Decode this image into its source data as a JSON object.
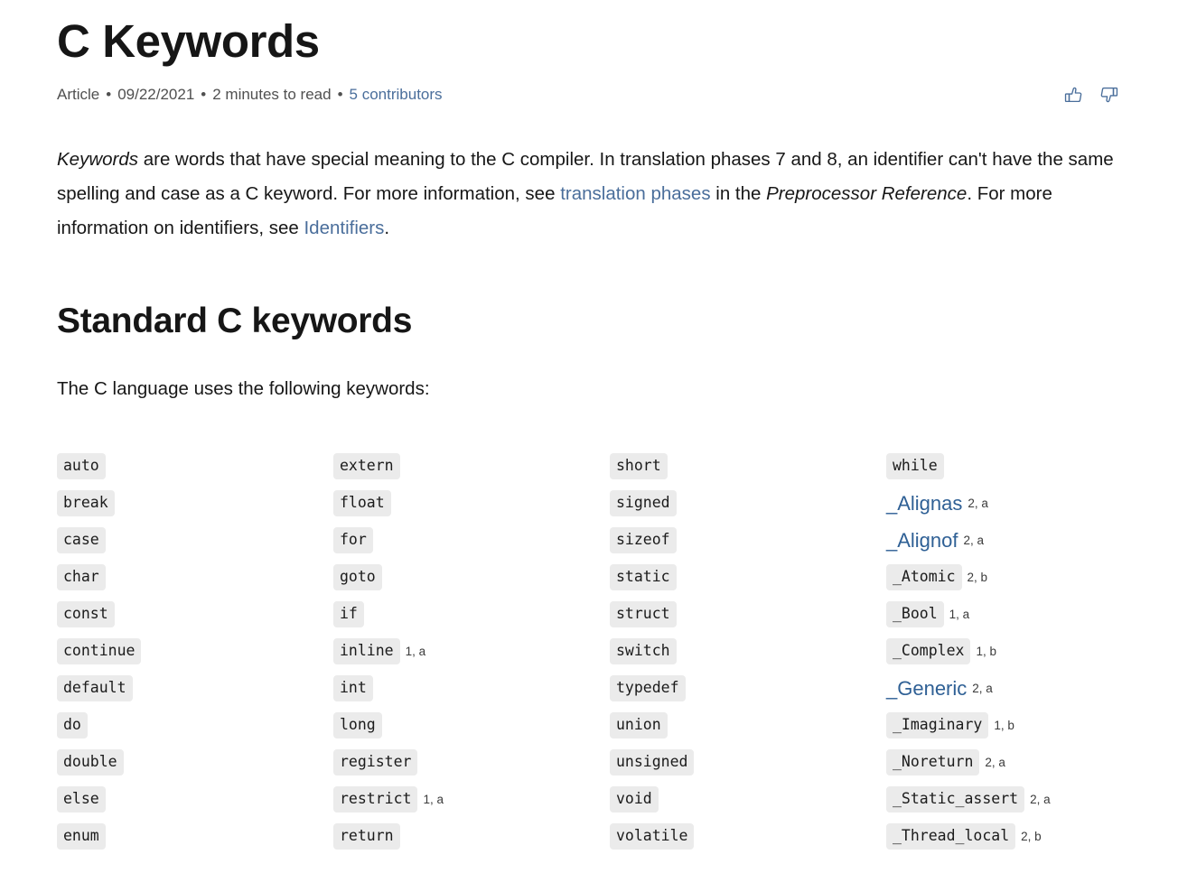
{
  "header": {
    "title": "C Keywords",
    "meta": {
      "type": "Article",
      "date": "09/22/2021",
      "read_time": "2 minutes to read",
      "contributors": "5 contributors",
      "separator": "•"
    },
    "feedback": {
      "thumbs_up_icon": "thumbs-up-icon",
      "thumbs_down_icon": "thumbs-down-icon"
    },
    "link_color": "#4a6e9b"
  },
  "intro": {
    "p1_a": "Keywords",
    "p1_b": " are words that have special meaning to the C compiler. In translation phases 7 and 8, an identifier can't have the same spelling and case as a C keyword. For more information, see ",
    "p1_link1": "translation phases",
    "p1_c": " in the ",
    "p1_italic2": "Preprocessor Reference",
    "p1_d": ". For more information on identifiers, see ",
    "p1_link2": "Identifiers",
    "p1_e": "."
  },
  "section": {
    "heading": "Standard C keywords",
    "lead": "The C language uses the following keywords:"
  },
  "keywords": {
    "code_bg": "#ebebeb",
    "link_color": "#2f6095",
    "columns": [
      [
        {
          "text": "auto",
          "style": "code",
          "note": ""
        },
        {
          "text": "break",
          "style": "code",
          "note": ""
        },
        {
          "text": "case",
          "style": "code",
          "note": ""
        },
        {
          "text": "char",
          "style": "code",
          "note": ""
        },
        {
          "text": "const",
          "style": "code",
          "note": ""
        },
        {
          "text": "continue",
          "style": "code",
          "note": ""
        },
        {
          "text": "default",
          "style": "code",
          "note": ""
        },
        {
          "text": "do",
          "style": "code",
          "note": ""
        },
        {
          "text": "double",
          "style": "code",
          "note": ""
        },
        {
          "text": "else",
          "style": "code",
          "note": ""
        },
        {
          "text": "enum",
          "style": "code",
          "note": ""
        }
      ],
      [
        {
          "text": "extern",
          "style": "code",
          "note": ""
        },
        {
          "text": "float",
          "style": "code",
          "note": ""
        },
        {
          "text": "for",
          "style": "code",
          "note": ""
        },
        {
          "text": "goto",
          "style": "code",
          "note": ""
        },
        {
          "text": "if",
          "style": "code",
          "note": ""
        },
        {
          "text": "inline",
          "style": "code",
          "note": "1, a"
        },
        {
          "text": "int",
          "style": "code",
          "note": ""
        },
        {
          "text": "long",
          "style": "code",
          "note": ""
        },
        {
          "text": "register",
          "style": "code",
          "note": ""
        },
        {
          "text": "restrict",
          "style": "code",
          "note": "1, a"
        },
        {
          "text": "return",
          "style": "code",
          "note": ""
        }
      ],
      [
        {
          "text": "short",
          "style": "code",
          "note": ""
        },
        {
          "text": "signed",
          "style": "code",
          "note": ""
        },
        {
          "text": "sizeof",
          "style": "code",
          "note": ""
        },
        {
          "text": "static",
          "style": "code",
          "note": ""
        },
        {
          "text": "struct",
          "style": "code",
          "note": ""
        },
        {
          "text": "switch",
          "style": "code",
          "note": ""
        },
        {
          "text": "typedef",
          "style": "code",
          "note": ""
        },
        {
          "text": "union",
          "style": "code",
          "note": ""
        },
        {
          "text": "unsigned",
          "style": "code",
          "note": ""
        },
        {
          "text": "void",
          "style": "code",
          "note": ""
        },
        {
          "text": "volatile",
          "style": "code",
          "note": ""
        }
      ],
      [
        {
          "text": "while",
          "style": "code",
          "note": ""
        },
        {
          "text": "_Alignas",
          "style": "link",
          "note": "2, a"
        },
        {
          "text": "_Alignof",
          "style": "link",
          "note": "2, a"
        },
        {
          "text": "_Atomic",
          "style": "code",
          "note": "2, b"
        },
        {
          "text": "_Bool",
          "style": "code",
          "note": "1, a"
        },
        {
          "text": "_Complex",
          "style": "code",
          "note": "1, b"
        },
        {
          "text": "_Generic",
          "style": "link",
          "note": "2, a"
        },
        {
          "text": "_Imaginary",
          "style": "code",
          "note": "1, b"
        },
        {
          "text": "_Noreturn",
          "style": "code",
          "note": "2, a"
        },
        {
          "text": "_Static_assert",
          "style": "code",
          "note": "2, a"
        },
        {
          "text": "_Thread_local",
          "style": "code",
          "note": "2, b"
        }
      ]
    ]
  }
}
